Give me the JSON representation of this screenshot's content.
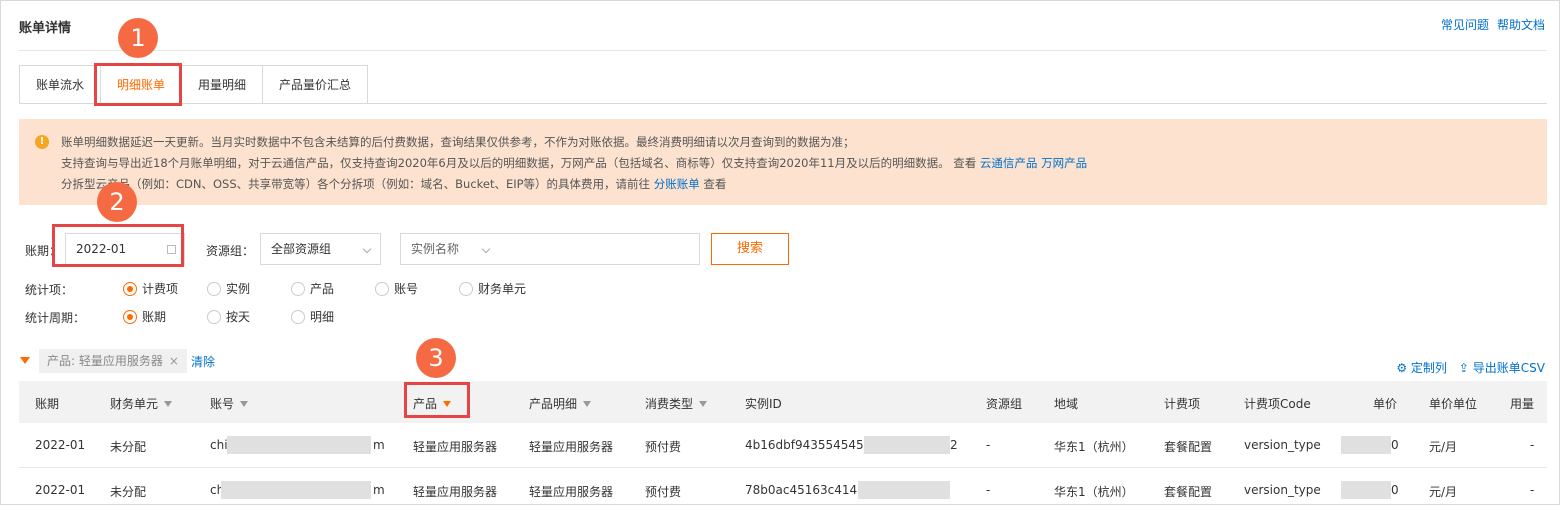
{
  "header": {
    "title": "账单详情",
    "links": [
      "常见问题",
      "帮助文档"
    ]
  },
  "tabs": [
    "账单流水",
    "明细账单",
    "用量明细",
    "产品量价汇总"
  ],
  "notice": {
    "line1": "账单明细数据延迟一天更新。当月实时数据中不包含未结算的后付费数据，查询结果仅供参考，不作为对账依据。最终消费明细请以次月查询到的数据为准；",
    "line2": "支持查询与导出近18个月账单明细，对于云通信产品，仅支持查询2020年6月及以后的明细数据，万网产品（包括域名、商标等）仅支持查询2020年11月及以后的明细数据。 查看 ",
    "line2_link1": "云通信产品",
    "line2_link2": "万网产品",
    "line3": "分拆型云产品（例如：CDN、OSS、共享带宽等）各个分拆项（例如：域名、Bucket、EIP等）的具体费用，请前往 ",
    "line3_link": "分账账单",
    "line3_tail": " 查看"
  },
  "filters": {
    "period_label": "账期：",
    "period_value": "2022-01",
    "group_label": "资源组：",
    "group_value": "全部资源组",
    "instance_placeholder": "实例名称",
    "search_label": "搜索",
    "stat_item_label": "统计项：",
    "stat_items": [
      "计费项",
      "实例",
      "产品",
      "账号",
      "财务单元"
    ],
    "stat_period_label": "统计周期：",
    "stat_periods": [
      "账期",
      "按天",
      "明细"
    ]
  },
  "active_filter": {
    "chip": "产品: 轻量应用服务器",
    "clear": "清除"
  },
  "actions": {
    "customize": "定制列",
    "export": "导出账单CSV"
  },
  "table": {
    "headers": [
      "账期",
      "财务单元",
      "账号",
      "产品",
      "产品明细",
      "消费类型",
      "实例ID",
      "资源组",
      "地域",
      "计费项",
      "计费项Code",
      "单价",
      "单价单位",
      "用量"
    ],
    "rows": [
      {
        "period": "2022-01",
        "unit": "未分配",
        "account_pre": "chi",
        "account_post": "m",
        "product": "轻量应用服务器",
        "detail": "轻量应用服务器",
        "type": "预付费",
        "instance": "4b16dbf94355454592a",
        "instance_tail": "2",
        "group": "-",
        "region": "华东1（杭州）",
        "item": "套餐配置",
        "code": "version_type",
        "price_tail": "0",
        "price_unit": "元/月",
        "usage": "-"
      },
      {
        "period": "2022-01",
        "unit": "未分配",
        "account_pre": "ch",
        "account_post": "m",
        "product": "轻量应用服务器",
        "detail": "轻量应用服务器",
        "type": "预付费",
        "instance": "78b0ac45163c41489",
        "instance_tail": "",
        "group": "-",
        "region": "华东1（杭州）",
        "item": "套餐配置",
        "code": "version_type",
        "price_tail": "0",
        "price_unit": "元/月",
        "usage": "-"
      }
    ]
  },
  "markers": [
    "1",
    "2",
    "3"
  ]
}
